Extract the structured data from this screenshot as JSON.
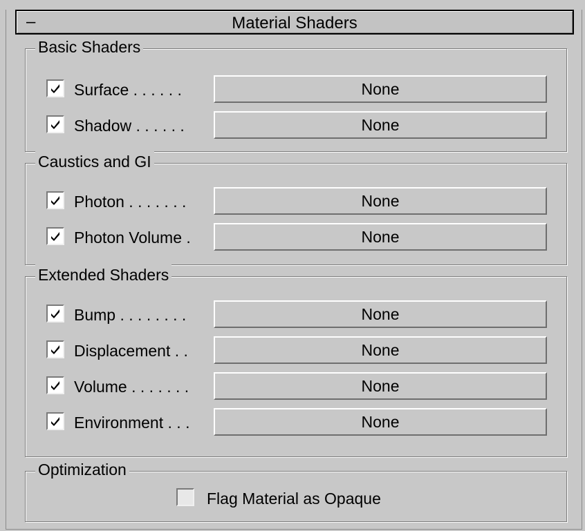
{
  "rollout": {
    "collapse_symbol": "–",
    "title": "Material Shaders"
  },
  "groups": {
    "basic": {
      "label": "Basic Shaders",
      "rows": [
        {
          "label": "Surface . . . . . .",
          "checked": true,
          "button": "None"
        },
        {
          "label": "Shadow . . . . . .",
          "checked": true,
          "button": "None"
        }
      ]
    },
    "caustics": {
      "label": "Caustics and GI",
      "rows": [
        {
          "label": "Photon . . . . . . .",
          "checked": true,
          "button": "None"
        },
        {
          "label": "Photon Volume .",
          "checked": true,
          "button": "None"
        }
      ]
    },
    "extended": {
      "label": "Extended Shaders",
      "rows": [
        {
          "label": "Bump . . . . . . . .",
          "checked": true,
          "button": "None"
        },
        {
          "label": "Displacement . .",
          "checked": true,
          "button": "None"
        },
        {
          "label": "Volume . . . . . . .",
          "checked": true,
          "button": "None"
        },
        {
          "label": "Environment . . .",
          "checked": true,
          "button": "None"
        }
      ]
    },
    "optimization": {
      "label": "Optimization",
      "opaque": {
        "label": "Flag Material as Opaque",
        "checked": false
      }
    }
  },
  "icons": {
    "checkmark": "checkmark-icon",
    "collapse": "minus-icon"
  },
  "colors": {
    "panel_bg": "#c8c8c8",
    "checkbox_bg": "#ffffff",
    "border_dark": "#7a7a7a",
    "border_light": "#ffffff"
  }
}
